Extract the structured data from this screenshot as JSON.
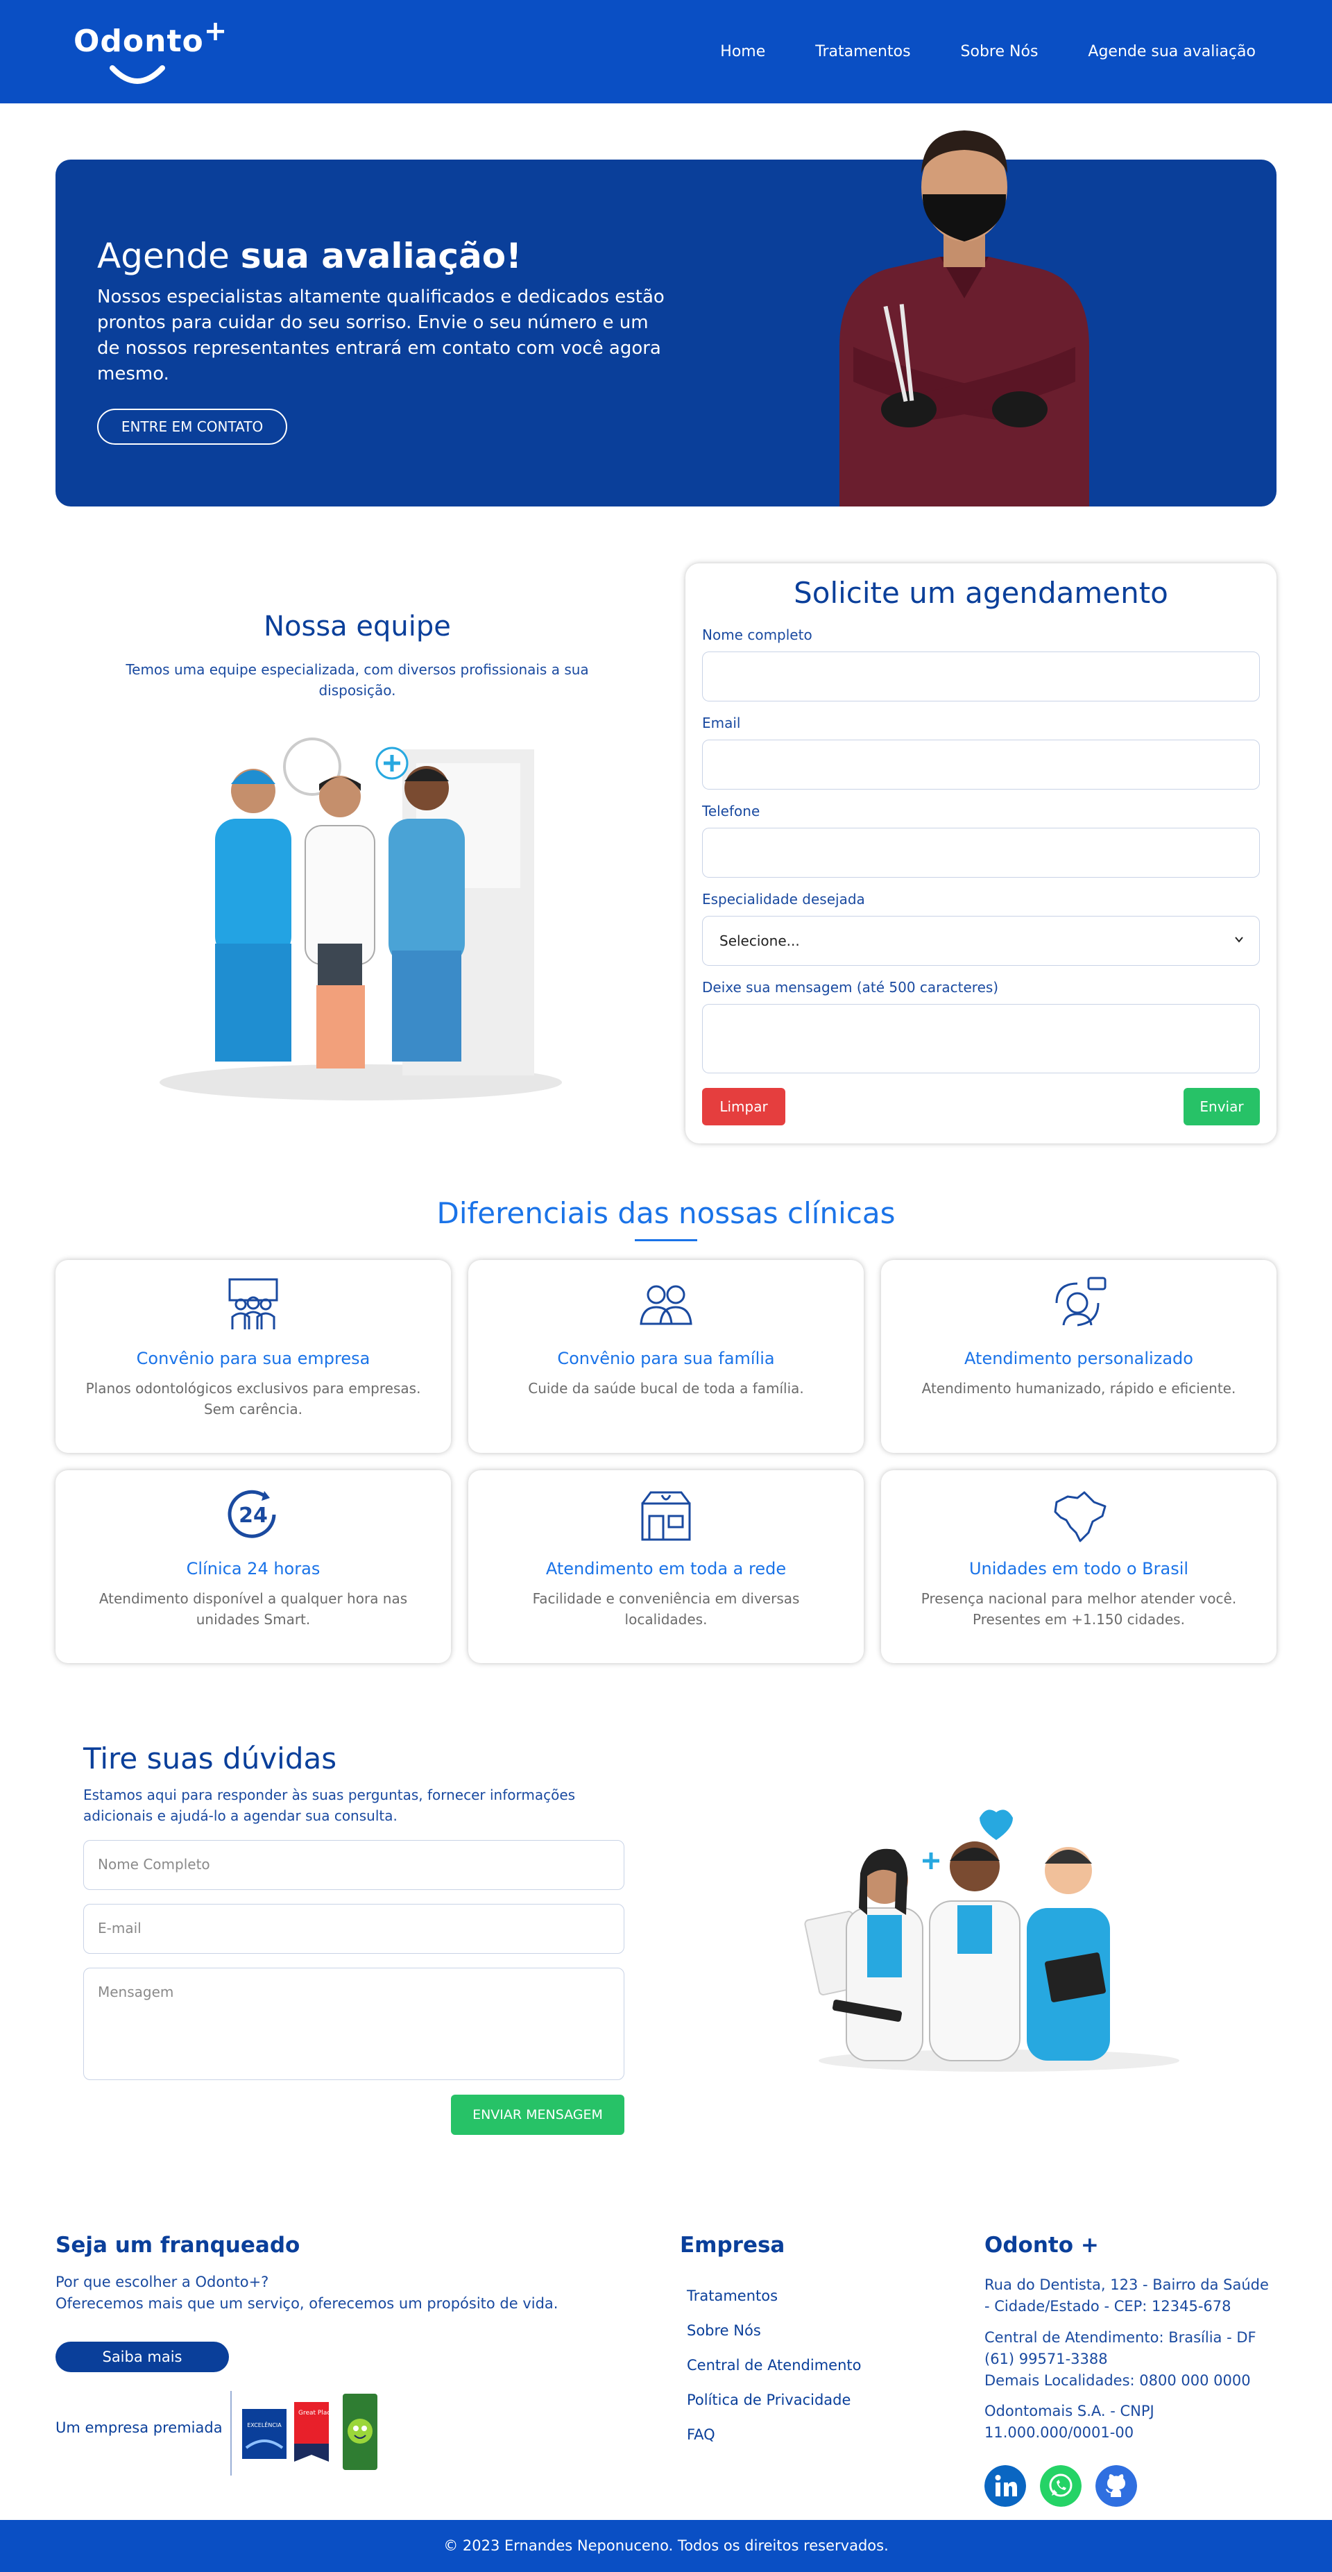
{
  "nav": {
    "logo": "Odonto",
    "logo_plus": "+",
    "links": [
      "Home",
      "Tratamentos",
      "Sobre Nós",
      "Agende sua avaliação"
    ]
  },
  "hero": {
    "title_light": "Agende ",
    "title_bold": "sua avaliação!",
    "text": "Nossos especialistas altamente qualificados e dedicados estão prontos para cuidar do seu sorriso. Envie o seu número e um de nossos representantes entrará em contato com você agora mesmo.",
    "button": "ENTRE EM CONTATO"
  },
  "team": {
    "title": "Nossa equipe",
    "text": "Temos uma equipe especializada, com diversos profissionais a sua disposição."
  },
  "booking": {
    "title": "Solicite um agendamento",
    "name_label": "Nome completo",
    "email_label": "Email",
    "phone_label": "Telefone",
    "specialty_label": "Especialidade desejada",
    "specialty_value": "Selecione...",
    "message_label": "Deixe sua mensagem (até 500 caracteres)",
    "clear_button": "Limpar",
    "send_button": "Enviar"
  },
  "differentials": {
    "title": "Diferenciais das nossas clínicas",
    "cards": [
      {
        "title": "Convênio para sua empresa",
        "text": "Planos odontológicos exclusivos para empresas. Sem carência.",
        "icon": "group-icon"
      },
      {
        "title": "Convênio para sua família",
        "text": "Cuide da saúde bucal de toda a família.",
        "icon": "family-icon"
      },
      {
        "title": "Atendimento personalizado",
        "text": "Atendimento humanizado, rápido e eficiente.",
        "icon": "support-icon"
      },
      {
        "title": "Clínica 24 horas",
        "text": "Atendimento disponível a qualquer hora nas unidades Smart.",
        "icon": "clock-24-icon"
      },
      {
        "title": "Atendimento em toda a rede",
        "text": "Facilidade e conveniência em diversas localidades.",
        "icon": "clinic-icon"
      },
      {
        "title": "Unidades em todo o Brasil",
        "text": "Presença nacional para melhor atender você. Presentes em +1.150 cidades.",
        "icon": "brazil-map-icon"
      }
    ]
  },
  "faq": {
    "title": "Tire suas dúvidas",
    "text": "Estamos aqui para responder às suas perguntas, fornecer informações adicionais e ajudá-lo a agendar sua consulta.",
    "name_placeholder": "Nome Completo",
    "email_placeholder": "E-mail",
    "message_placeholder": "Mensagem",
    "button": "ENVIAR MENSAGEM"
  },
  "footer": {
    "franchise_title": "Seja um franqueado",
    "franchise_line1": "Por que escolher a Odonto+?",
    "franchise_line2": "Oferecemos mais que um serviço, oferecemos um propósito de vida.",
    "franchise_button": "Saiba mais",
    "award_label": "Um empresa premiada",
    "award_badge_1": "EXCELÊNCIA",
    "award_badge_2": "Great Place To Work",
    "company_title": "Empresa",
    "company_links": [
      "Tratamentos",
      "Sobre Nós",
      "Central de Atendimento",
      "Política de Privacidade",
      "FAQ"
    ],
    "brand_title": "Odonto +",
    "address": "Rua do Dentista, 123 - Bairro da Saúde - Cidade/Estado - CEP: 12345-678",
    "phone_central": "Central de Atendimento: Brasília - DF (61) 99571-3388",
    "phone_other": "Demais Localidades: 0800 000 0000",
    "cnpj": "Odontomais S.A. - CNPJ 11.000.000/0001-00",
    "social": [
      "linkedin-icon",
      "whatsapp-icon",
      "github-icon"
    ],
    "copyright": "© 2023 Ernandes Neponuceno. Todos os direitos reservados."
  },
  "colors": {
    "primary": "#0a4fc4",
    "dark_blue": "#0a3f9a",
    "accent": "#1a73e8",
    "green": "#27c267",
    "red": "#e53e3e"
  }
}
